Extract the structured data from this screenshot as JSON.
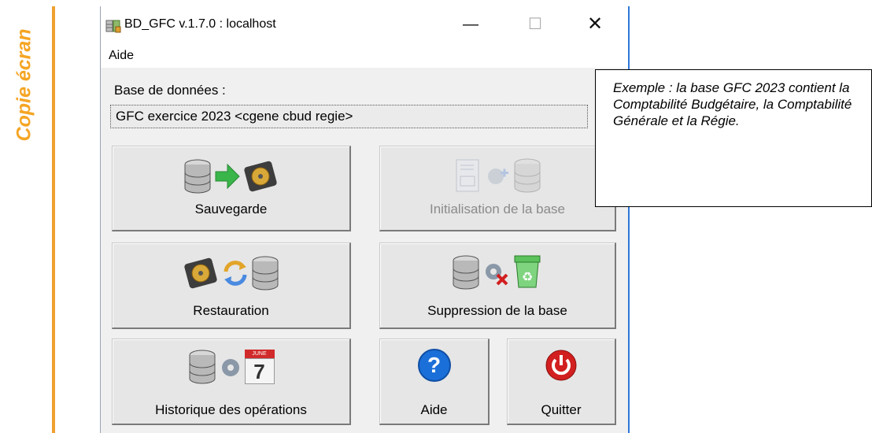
{
  "side_label": "Copie écran",
  "window": {
    "title": "BD_GFC v.1.7.0 : localhost",
    "controls": {
      "minimize": "—",
      "maximize": "☐",
      "close": "✕"
    },
    "menu": [
      "Aide"
    ],
    "db_label": "Base de données :",
    "db_value": "GFC exercice 2023 <cgene cbud regie>",
    "buttons": {
      "sauvegarde": "Sauvegarde",
      "initialisation": "Initialisation de la base",
      "restauration": "Restauration",
      "suppression": "Suppression de la base",
      "historique": "Historique des opérations",
      "aide": "Aide",
      "quitter": "Quitter"
    },
    "calendar": {
      "month": "JUNE",
      "day": "7"
    },
    "help_glyph": "?"
  },
  "annotation": "Exemple : la base GFC 2023 contient la Comptabilité Budgétaire, la Comptabilité Générale et la Régie.",
  "colors": {
    "side_label": "#f5a524",
    "window_border": "#2b78d8",
    "arrow_green": "#39b54a",
    "help_blue": "#1b6fd8",
    "quit_red": "#d21f1f"
  }
}
